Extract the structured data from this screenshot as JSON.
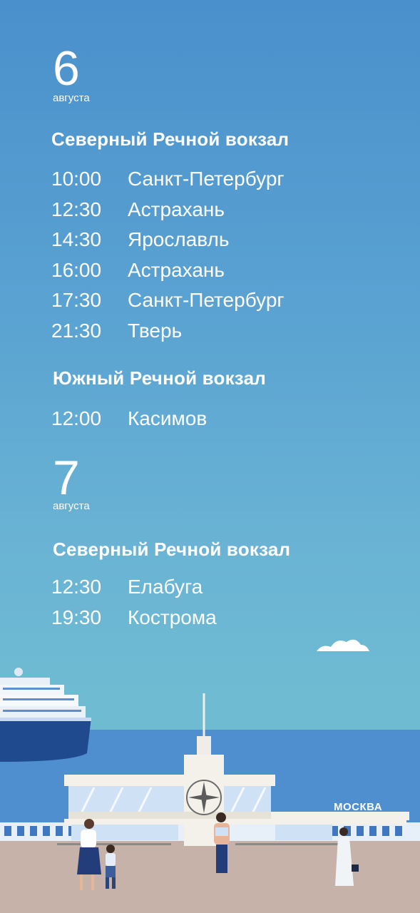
{
  "days": [
    {
      "day": "6",
      "month": "августа",
      "stations": [
        {
          "name": "Северный Речной вокзал",
          "departures": [
            {
              "time": "10:00",
              "destination": "Санкт-Петербург"
            },
            {
              "time": "12:30",
              "destination": "Астрахань"
            },
            {
              "time": "14:30",
              "destination": "Ярославль"
            },
            {
              "time": "16:00",
              "destination": "Астрахань"
            },
            {
              "time": "17:30",
              "destination": "Санкт-Петербург"
            },
            {
              "time": "21:30",
              "destination": "Тверь"
            }
          ]
        },
        {
          "name": "Южный Речной вокзал",
          "departures": [
            {
              "time": "12:00",
              "destination": "Касимов"
            }
          ]
        }
      ]
    },
    {
      "day": "7",
      "month": "августа",
      "stations": [
        {
          "name": "Северный Речной вокзал",
          "departures": [
            {
              "time": "12:30",
              "destination": "Елабуга"
            },
            {
              "time": "19:30",
              "destination": "Кострома"
            }
          ]
        }
      ]
    }
  ],
  "logo": "МОСКВА",
  "colors": {
    "sky_top": "#4a90cc",
    "sky_bottom": "#72c0d0",
    "water": "#4f8fcf",
    "ground": "#c7b2a9",
    "ship_hull": "#1f4a8e",
    "logo_accent": "#d33c4a"
  },
  "illustration": {
    "icons": [
      "cloud-icon",
      "cruise-ship-icon",
      "river-station-icon",
      "compass-rose-icon"
    ]
  }
}
